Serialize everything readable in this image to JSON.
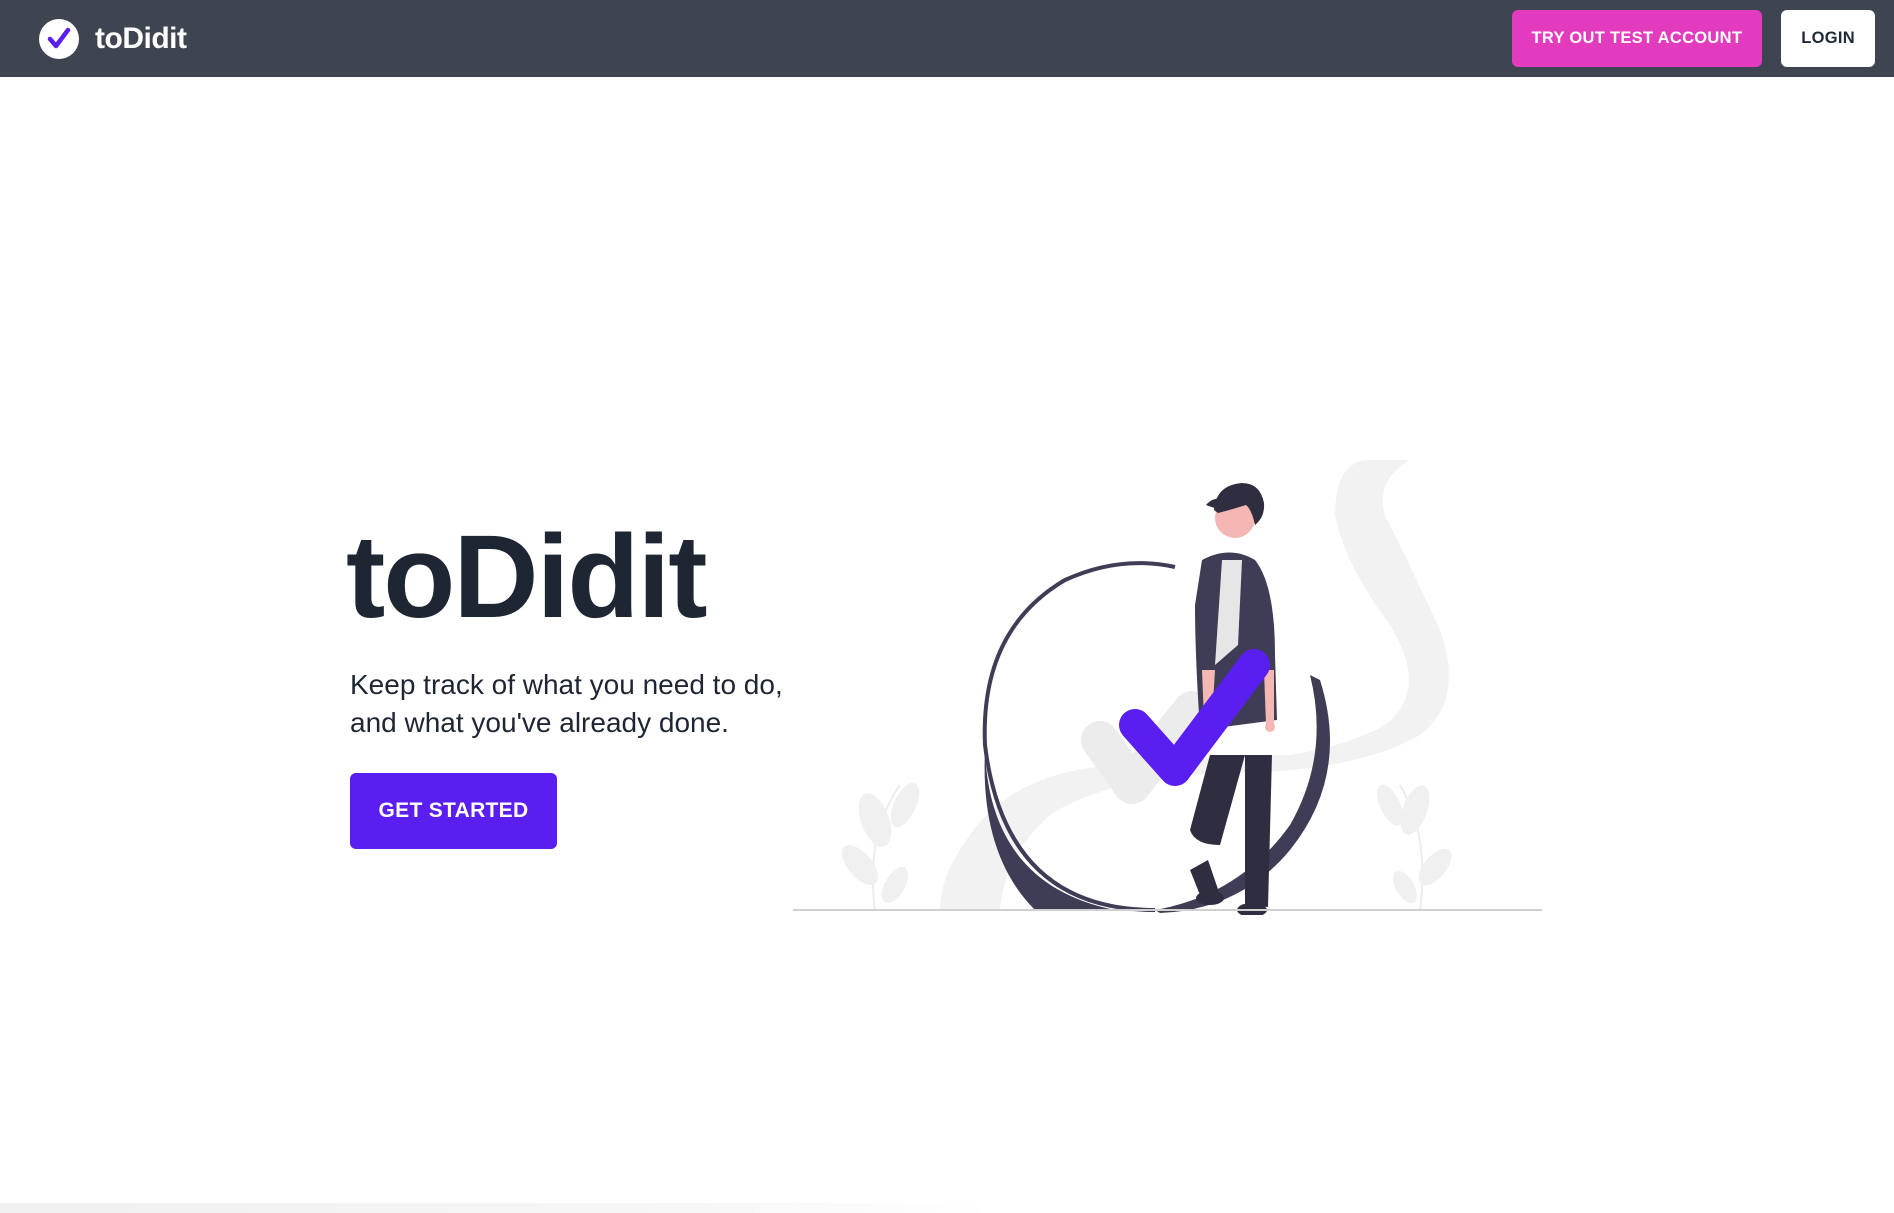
{
  "navbar": {
    "brand_name": "toDidit",
    "logo_icon": "check-circle-icon",
    "try_button_label": "TRY OUT TEST ACCOUNT",
    "login_button_label": "LOGIN"
  },
  "hero": {
    "title": "toDidit",
    "subtitle_line1": "Keep track of what you need to do,",
    "subtitle_line2": "and what you've already done.",
    "cta_label": "GET STARTED"
  },
  "colors": {
    "navbar_bg": "#3f4451",
    "accent_pink": "#e33bbd",
    "primary_purple": "#5a1ef0",
    "text_dark": "#1e2633"
  }
}
